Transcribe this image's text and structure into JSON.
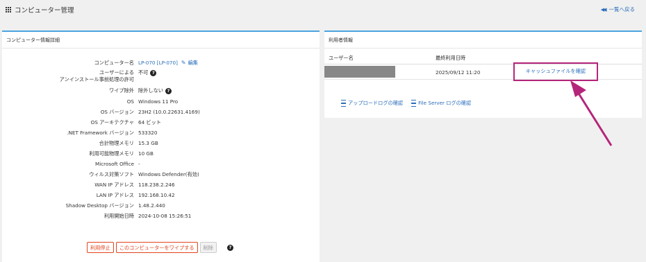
{
  "header": {
    "title": "コンピューター管理",
    "back_label": "一覧へ戻る"
  },
  "computer_panel": {
    "title": "コンピューター情報詳細",
    "fields": {
      "name_label": "コンピューター名",
      "name_value": "LP-070 [LP-070]",
      "edit_label": "編集",
      "uninstall_label_1": "ユーザーによる",
      "uninstall_label_2": "アンインストール事前処理の許可",
      "uninstall_value": "不可",
      "wipe_label": "ワイプ除外",
      "wipe_value": "除外しない",
      "os_label": "OS",
      "os_value": "Windows 11 Pro",
      "os_version_label": "OS バージョン",
      "os_version_value": "23H2 (10.0.22631.4169)",
      "os_arch_label": "OS アーキテクチャ",
      "os_arch_value": "64 ビット",
      "dotnet_label": ".NET Framework バージョン",
      "dotnet_value": "533320",
      "total_mem_label": "合計物理メモリ",
      "total_mem_value": "15.3 GB",
      "avail_mem_label": "利用可能物理メモリ",
      "avail_mem_value": "10 GB",
      "office_label": "Microsoft Office",
      "office_value": "-",
      "av_label": "ウィルス対策ソフト",
      "av_value": "Windows Defender(有効)",
      "wan_label": "WAN IP アドレス",
      "wan_value": "118.238.2.246",
      "lan_label": "LAN IP アドレス",
      "lan_value": "192.168.10.42",
      "shadow_label": "Shadow Desktop バージョン",
      "shadow_value": "1.48.2.440",
      "start_label": "利用開始日時",
      "start_value": "2024-10-08 15:26:51"
    },
    "buttons": {
      "stop": "利用停止",
      "wipe": "このコンピューターをワイプする",
      "delete": "削除"
    }
  },
  "user_panel": {
    "title": "利用者情報",
    "col_user": "ユーザー名",
    "col_last_used": "最終利用日時",
    "row": {
      "last_used": "2025/09/12 11:20",
      "cache_link": "キャッシュファイルを確認"
    },
    "upload_log": "アップロードログの確認",
    "file_server_log": "File Server ログの確認"
  },
  "colors": {
    "accent": "#4aa3df",
    "link": "#2a6ebb",
    "danger": "#e2431c",
    "highlight": "#b5257a"
  }
}
